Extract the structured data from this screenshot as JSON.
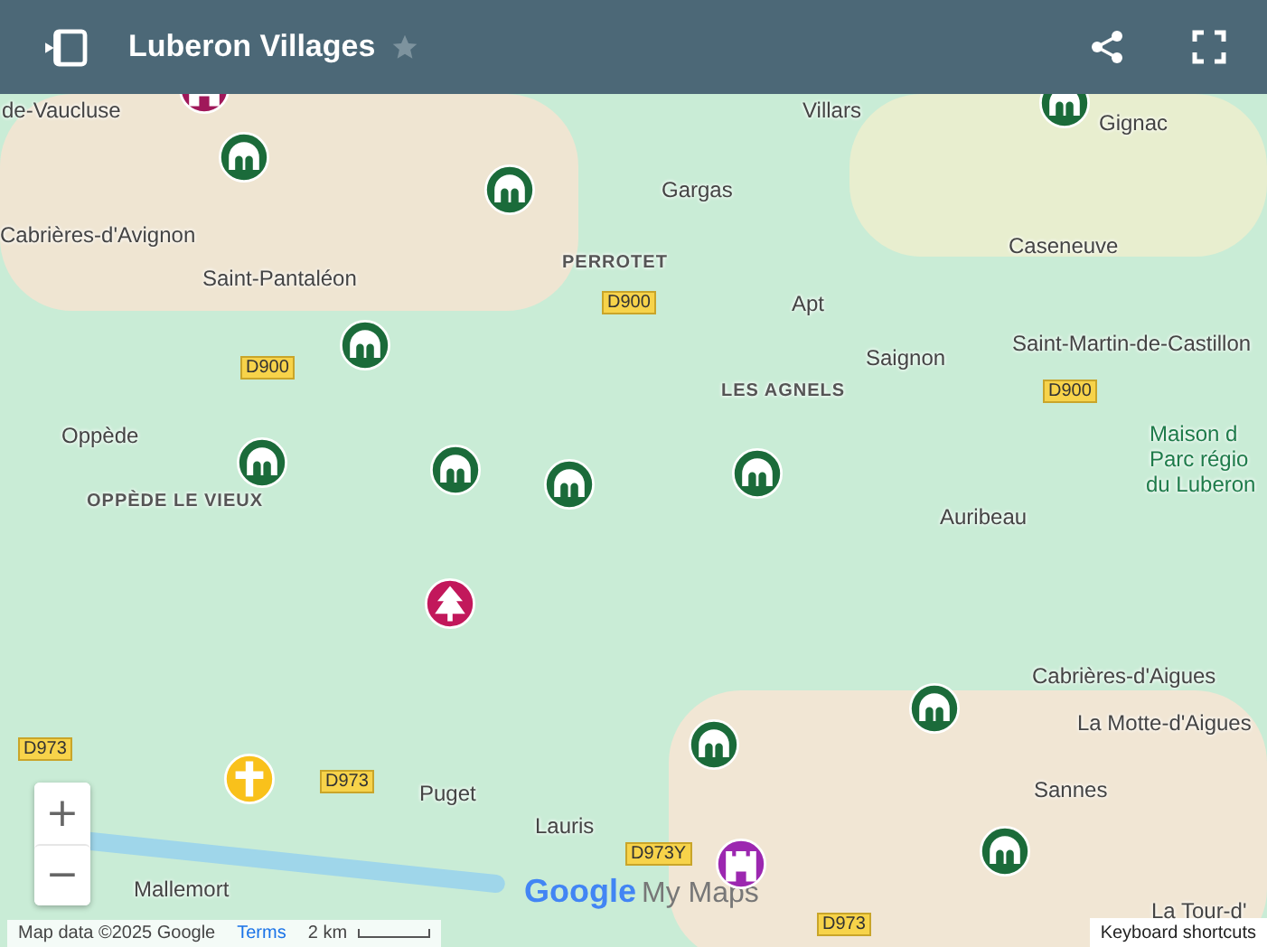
{
  "header": {
    "title": "Luberon Villages",
    "starred": false
  },
  "map": {
    "labels": [
      {
        "text": "de-Vaucluse",
        "kind": "place"
      },
      {
        "text": "Villars",
        "kind": "place"
      },
      {
        "text": "Gignac",
        "kind": "place"
      },
      {
        "text": "Gargas",
        "kind": "place"
      },
      {
        "text": "Cabrières-d'Avignon",
        "kind": "place"
      },
      {
        "text": "Saint-Pantaléon",
        "kind": "place"
      },
      {
        "text": "PERROTET",
        "kind": "area"
      },
      {
        "text": "Caseneuve",
        "kind": "place"
      },
      {
        "text": "D900",
        "kind": "road"
      },
      {
        "text": "Apt",
        "kind": "place"
      },
      {
        "text": "Saignon",
        "kind": "place"
      },
      {
        "text": "D900",
        "kind": "road"
      },
      {
        "text": "LES AGNELS",
        "kind": "area"
      },
      {
        "text": "Saint-Martin-de-Castillon",
        "kind": "place"
      },
      {
        "text": "D900",
        "kind": "road"
      },
      {
        "text": "Maison d",
        "kind": "poi"
      },
      {
        "text": "Parc régio",
        "kind": "poi"
      },
      {
        "text": "du Luberon",
        "kind": "poi"
      },
      {
        "text": "Oppède",
        "kind": "place"
      },
      {
        "text": "OPPÈDE LE VIEUX",
        "kind": "area"
      },
      {
        "text": "Auribeau",
        "kind": "place"
      },
      {
        "text": "Cabrières-d'Aigues",
        "kind": "place"
      },
      {
        "text": "La Motte-d'Aigues",
        "kind": "place"
      },
      {
        "text": "D973",
        "kind": "road"
      },
      {
        "text": "D973",
        "kind": "road"
      },
      {
        "text": "Puget",
        "kind": "place"
      },
      {
        "text": "Sannes",
        "kind": "place"
      },
      {
        "text": "Lauris",
        "kind": "place"
      },
      {
        "text": "D973Y",
        "kind": "road"
      },
      {
        "text": "Mallemort",
        "kind": "place"
      },
      {
        "text": "La Tour-d'",
        "kind": "place"
      },
      {
        "text": "D973",
        "kind": "road"
      }
    ],
    "pins": [
      {
        "kind": "castle",
        "color": "#a0185a"
      },
      {
        "kind": "village",
        "color": "#1b6b3a"
      },
      {
        "kind": "village",
        "color": "#1b6b3a"
      },
      {
        "kind": "village",
        "color": "#1b6b3a"
      },
      {
        "kind": "village",
        "color": "#1b6b3a"
      },
      {
        "kind": "village",
        "color": "#1b6b3a"
      },
      {
        "kind": "village",
        "color": "#1b6b3a"
      },
      {
        "kind": "village",
        "color": "#1b6b3a"
      },
      {
        "kind": "village",
        "color": "#1b6b3a"
      },
      {
        "kind": "tree",
        "color": "#c2185b"
      },
      {
        "kind": "village",
        "color": "#1b6b3a"
      },
      {
        "kind": "village",
        "color": "#1b6b3a"
      },
      {
        "kind": "cross",
        "color": "#f9c11b"
      },
      {
        "kind": "castle",
        "color": "#9c27b0"
      },
      {
        "kind": "village",
        "color": "#1b6b3a"
      }
    ]
  },
  "zoom": {
    "in": "+",
    "out": "−"
  },
  "logo": {
    "brand": "Google",
    "product": "My Maps"
  },
  "attribution": {
    "data": "Map data ©2025 Google",
    "terms": "Terms",
    "scale": "2 km"
  },
  "shortcuts": "Keyboard shortcuts"
}
